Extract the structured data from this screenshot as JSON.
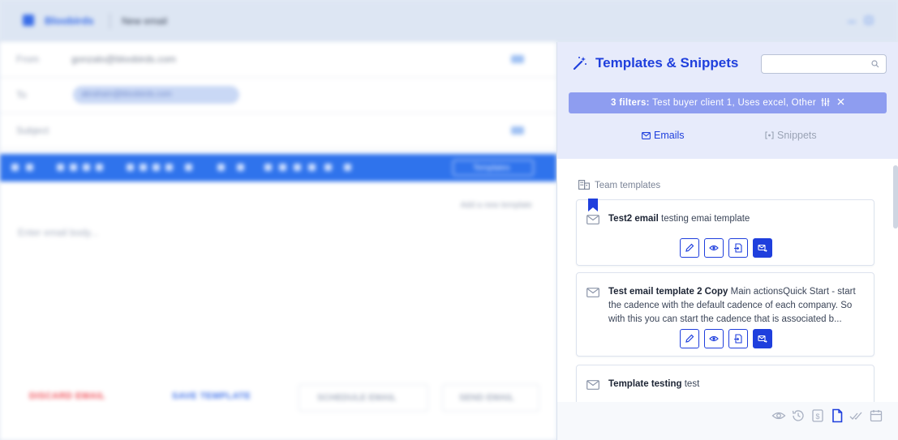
{
  "window": {
    "app_name": "Bloobirds",
    "title": "New email"
  },
  "compose": {
    "from_label": "From",
    "from_value": "gonzalo@bloobirds.com",
    "to_label": "To",
    "to_chip": "abraham@bloobirds.com",
    "subject_label": "Subject",
    "templates_button": "Templates",
    "link_text": "Add a new template",
    "body_placeholder": "Enter email body...",
    "footer": {
      "discard": "DISCARD EMAIL",
      "save_template": "SAVE TEMPLATE",
      "schedule": "SCHEDULE EMAIL",
      "send": "SEND EMAIL"
    }
  },
  "panel": {
    "title": "Templates & Snippets",
    "search_placeholder": "",
    "filters_bold": "3 filters:",
    "filters_text": "Test buyer client 1, Uses excel, Other",
    "tabs": [
      {
        "label": "Emails",
        "active": true
      },
      {
        "label": "Snippets",
        "active": false
      }
    ],
    "section_label": "Team templates",
    "templates": [
      {
        "name": "Test2 email",
        "body": "testing emai template",
        "bookmarked": true
      },
      {
        "name": "Test email template 2 Copy",
        "body": "Main actionsQuick Start - start the cadence with the default cadence of each company. So with this you can start the cadence that is associated b...",
        "bookmarked": false
      },
      {
        "name": "Template testing",
        "body": "test",
        "bookmarked": false
      }
    ],
    "bottom_icons": [
      "eye-icon",
      "history-icon",
      "dollar-icon",
      "document-icon",
      "double-check-icon",
      "calendar-icon"
    ]
  },
  "colors": {
    "accent": "#1f3fdd",
    "filter_bar": "#8e9df0",
    "panel_header": "#e7ebfb",
    "compose_toolbar": "#2f73ec"
  }
}
